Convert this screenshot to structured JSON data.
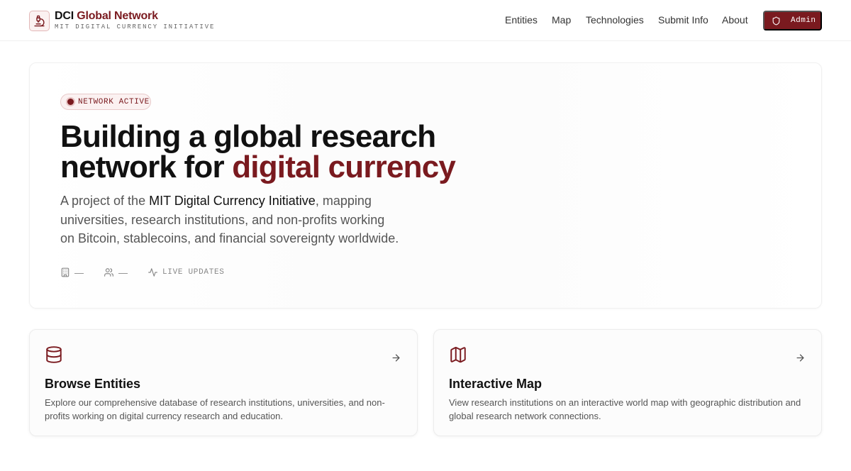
{
  "brand": {
    "title_accent": "DCI",
    "title_rest": " Global Network",
    "subtitle": "MIT DIGITAL CURRENCY INITIATIVE"
  },
  "nav": {
    "items": [
      "Entities",
      "Map",
      "Technologies",
      "Submit Info",
      "About"
    ],
    "admin_label": "Admin"
  },
  "hero": {
    "badge": "NETWORK ACTIVE",
    "headline_line1": "Building a global research",
    "headline_line2_plain": "network for ",
    "headline_line2_accent": "digital currency",
    "lead_prefix": "A project of the ",
    "lead_strong": "MIT Digital Currency Initiative",
    "lead_suffix": ", mapping universities, research institutions, and non-profits working on Bitcoin, stablecoins, and financial sovereignty worldwide.",
    "stats": {
      "institutions": "—",
      "people": "—",
      "live": "LIVE UPDATES"
    }
  },
  "cards": [
    {
      "title": "Browse Entities",
      "description": "Explore our comprehensive database of research institutions, universities, and non-profits working on digital currency research and education.",
      "icon": "database-icon"
    },
    {
      "title": "Interactive Map",
      "description": "View research institutions on an interactive world map with geographic distribution and global research network connections.",
      "icon": "map-icon"
    }
  ],
  "colors": {
    "accent": "#7a1a1f",
    "badge_bg": "#fbf1f1",
    "text": "#111111",
    "muted": "#555555"
  }
}
